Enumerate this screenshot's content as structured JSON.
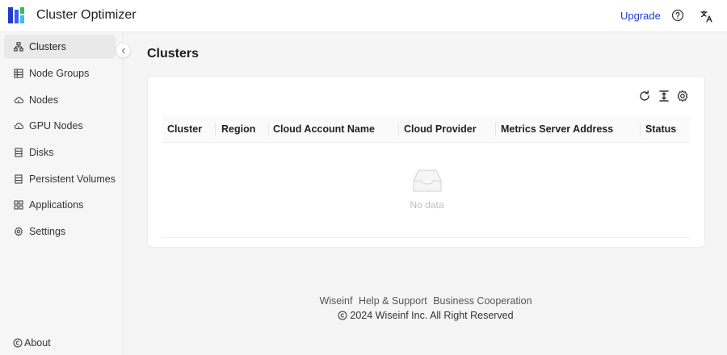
{
  "header": {
    "app_title": "Cluster Optimizer",
    "upgrade_label": "Upgrade",
    "brand_colors": [
      "#1e3cc8",
      "#3d5af1",
      "#22c55e",
      "#38bdf8"
    ]
  },
  "sidebar": {
    "items": [
      {
        "label": "Clusters",
        "icon": "cluster-icon",
        "active": true
      },
      {
        "label": "Node Groups",
        "icon": "node-groups-icon"
      },
      {
        "label": "Nodes",
        "icon": "cloud-icon"
      },
      {
        "label": "GPU Nodes",
        "icon": "cloud-icon"
      },
      {
        "label": "Disks",
        "icon": "disk-icon"
      },
      {
        "label": "Persistent Volumes",
        "icon": "volume-icon"
      },
      {
        "label": "Applications",
        "icon": "grid-icon"
      },
      {
        "label": "Settings",
        "icon": "gear-icon"
      }
    ],
    "about_label": "About"
  },
  "main": {
    "page_title": "Clusters",
    "table": {
      "columns": [
        "Cluster",
        "Region",
        "Cloud Account Name",
        "Cloud Provider",
        "Metrics Server Address",
        "Status"
      ],
      "rows": [],
      "empty_text": "No data"
    }
  },
  "footer": {
    "links": [
      "Wiseinf",
      "Help & Support",
      "Business Cooperation"
    ],
    "copyright": "2024 Wiseinf Inc. All Right Reserved"
  }
}
